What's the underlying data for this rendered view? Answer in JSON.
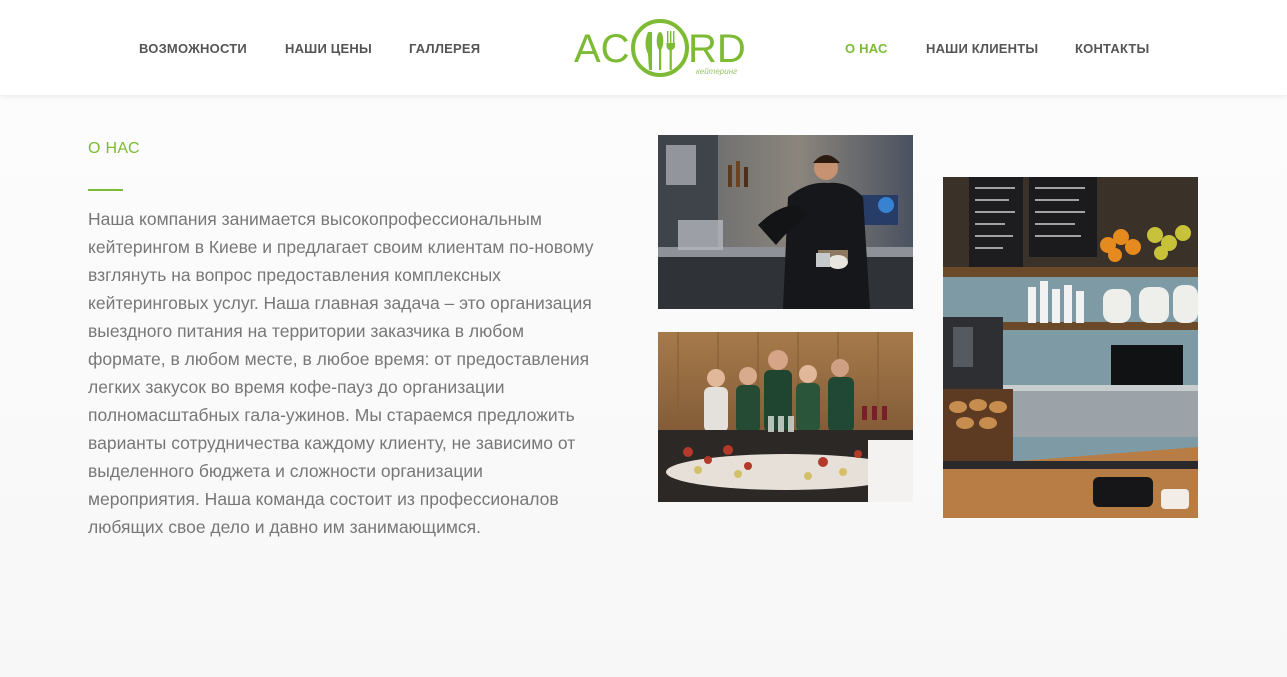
{
  "nav": {
    "left": [
      "ВОЗМОЖНОСТИ",
      "НАШИ ЦЕНЫ",
      "ГАЛЛЕРЕЯ"
    ],
    "right": [
      "О НАС",
      "НАШИ КЛИЕНТЫ",
      "КОНТАКТЫ"
    ],
    "active": "О НАС"
  },
  "logo": {
    "left_text": "AC",
    "right_text": "RD",
    "tagline": "кейтеринг"
  },
  "about": {
    "title": "О НАС",
    "text": "Наша компания занимается высокопрофессиональным кейтерингом в Киеве и предлагает своим клиентам по-новому взглянуть на вопрос предоставления комплексных кейтеринговых услуг.  Наша главная задача – это организация выездного питания на территории заказчика в любом формате, в любом месте, в любое время: от предоставления легких закусок во время кофе-пауз до организации полномасштабных гала-ужинов. Мы стараемся предложить варианты сотрудничества каждому клиенту, не зависимо от выделенного бюджета и сложности организации мероприятия. Наша команда состоит из профессионалов любящих свое дело и давно им занимающимся."
  },
  "gallery": {
    "photos": [
      "barista-photo",
      "team-photo",
      "cafe-counter-photo"
    ]
  },
  "colors": {
    "accent": "#7dbb34",
    "nav_text": "#555555",
    "body_text": "#777777",
    "background": "#f9f9f9"
  }
}
